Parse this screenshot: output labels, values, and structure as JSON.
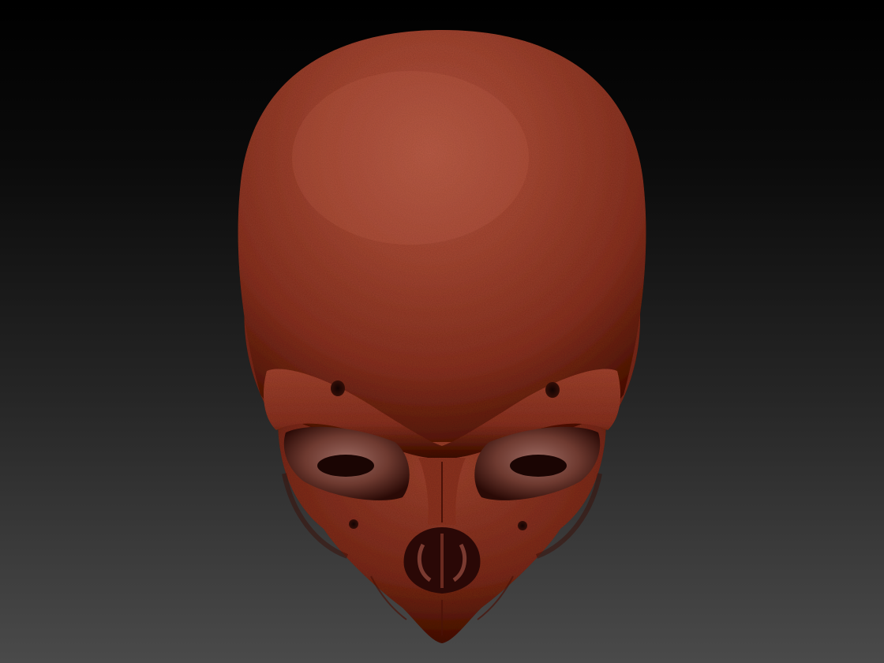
{
  "scene": {
    "subject": "skull-sculpt",
    "view": "top-front",
    "colors": {
      "background_top": "#000000",
      "background_bottom": "#4a4a4a",
      "clay_base": "#9a3a28",
      "clay_highlight": "#c8604a",
      "clay_shadow": "#3a1008",
      "cavity_shadow": "#1e0604"
    }
  }
}
